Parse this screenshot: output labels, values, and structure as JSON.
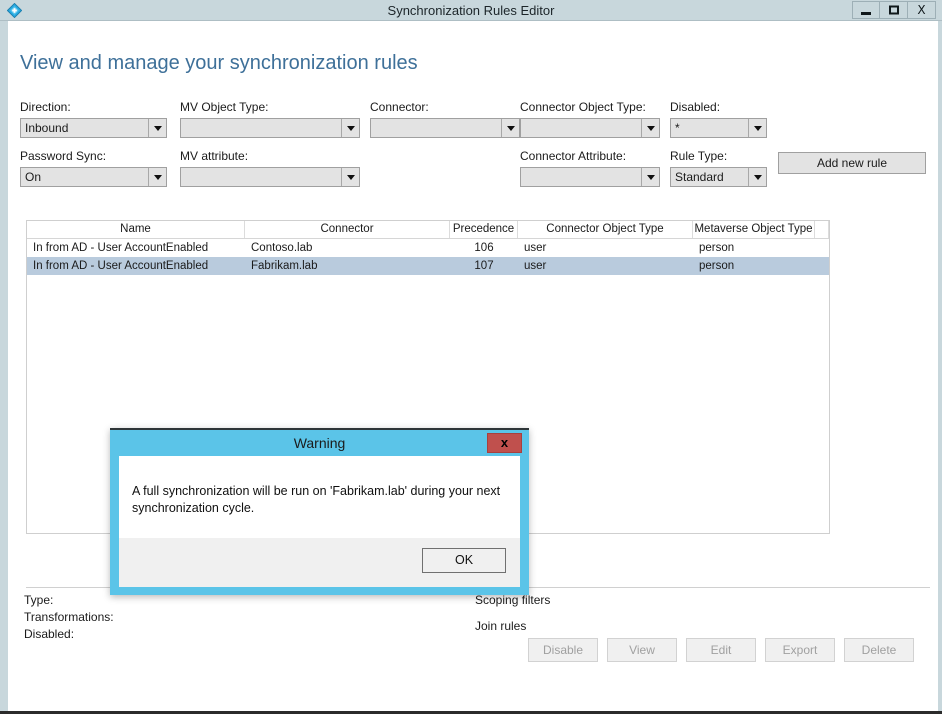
{
  "window": {
    "title": "Synchronization Rules Editor",
    "app_icon": "diamond-app-icon",
    "minimize_label": "Minimize",
    "maximize_label": "Maximize",
    "close_label": "X"
  },
  "page": {
    "heading": "View and manage your synchronization rules"
  },
  "filters": {
    "direction": {
      "label": "Direction:",
      "value": "Inbound"
    },
    "mv_object_type": {
      "label": "MV Object Type:",
      "value": ""
    },
    "connector": {
      "label": "Connector:",
      "value": ""
    },
    "connector_object_type": {
      "label": "Connector Object Type:",
      "value": ""
    },
    "disabled": {
      "label": "Disabled:",
      "value": "*"
    },
    "password_sync": {
      "label": "Password Sync:",
      "value": "On"
    },
    "mv_attribute": {
      "label": "MV attribute:",
      "value": ""
    },
    "connector_attribute": {
      "label": "Connector Attribute:",
      "value": ""
    },
    "rule_type": {
      "label": "Rule Type:",
      "value": "Standard"
    },
    "add_new_rule": "Add new rule"
  },
  "rules_table": {
    "columns": [
      "Name",
      "Connector",
      "Precedence",
      "Connector Object Type",
      "Metaverse Object Type"
    ],
    "rows": [
      {
        "name": "In from AD - User AccountEnabled",
        "connector": "Contoso.lab",
        "precedence": "106",
        "connector_object_type": "user",
        "metaverse_object_type": "person",
        "selected": false
      },
      {
        "name": "In from AD - User AccountEnabled",
        "connector": "Fabrikam.lab",
        "precedence": "107",
        "connector_object_type": "user",
        "metaverse_object_type": "person",
        "selected": true
      }
    ]
  },
  "details": {
    "type_label": "Type:",
    "transformations_label": "Transformations:",
    "disabled_label": "Disabled:",
    "scoping_filters_label": "Scoping filters",
    "join_rules_label": "Join rules"
  },
  "actions": {
    "disable": "Disable",
    "view": "View",
    "edit": "Edit",
    "export": "Export",
    "delete": "Delete"
  },
  "dialog": {
    "title": "Warning",
    "close_label": "x",
    "message": "A full synchronization will be run on 'Fabrikam.lab' during your next synchronization cycle.",
    "ok_label": "OK"
  },
  "colors": {
    "titlebar": "#c8d7dc",
    "heading": "#3e7099",
    "dialog_border": "#5bc4e8",
    "dialog_close": "#c0504d",
    "row_selected": "#b9cbdd"
  }
}
